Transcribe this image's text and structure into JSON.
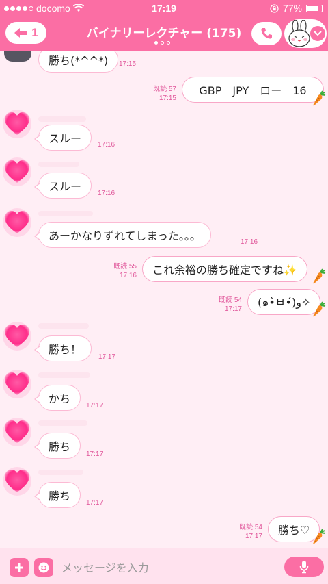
{
  "status": {
    "carrier": "docomo",
    "time": "17:19",
    "battery": "77%",
    "battery_level": 0.77,
    "signal_bars": 4
  },
  "nav": {
    "back_count": "1",
    "title": "バイナリーレクチャー (175)"
  },
  "messages": [
    {
      "side": "in",
      "text": "勝ち(*^^*)",
      "time": "17:15"
    },
    {
      "side": "out",
      "text": "GBP　JPY　ロー　16",
      "read": "既読 57",
      "time": "17:15"
    },
    {
      "side": "in",
      "text": "スルー",
      "time": "17:16"
    },
    {
      "side": "in",
      "text": "スルー",
      "time": "17:16"
    },
    {
      "side": "in",
      "text": "あーかなりずれてしまった。。。",
      "time": "17:16"
    },
    {
      "side": "out",
      "text": "これ余裕の勝ち確定ですね✨",
      "read": "既読 55",
      "time": "17:16"
    },
    {
      "side": "out",
      "text": "(๑•̀ㅂ•́)و✧",
      "read": "既読 54",
      "time": "17:17"
    },
    {
      "side": "in",
      "text": "勝ち！",
      "time": "17:17"
    },
    {
      "side": "in",
      "text": "かち",
      "time": "17:17"
    },
    {
      "side": "in",
      "text": "勝ち",
      "time": "17:17"
    },
    {
      "side": "in",
      "text": "勝ち",
      "time": "17:17"
    },
    {
      "side": "out",
      "text": "勝ち♡",
      "read": "既読 54",
      "time": "17:17"
    }
  ],
  "input": {
    "placeholder": "メッセージを入力"
  },
  "colors": {
    "accent": "#fb6ea4",
    "background": "#ffeef5",
    "timestamp": "#e0569a"
  },
  "icons": [
    "back-arrow-icon",
    "phone-icon",
    "bunny-sticker-icon",
    "chevron-down-icon",
    "heart-avatar-icon",
    "carrot-icon",
    "plus-icon",
    "emoji-icon",
    "mic-icon",
    "wifi-icon",
    "lock-rotation-icon"
  ]
}
